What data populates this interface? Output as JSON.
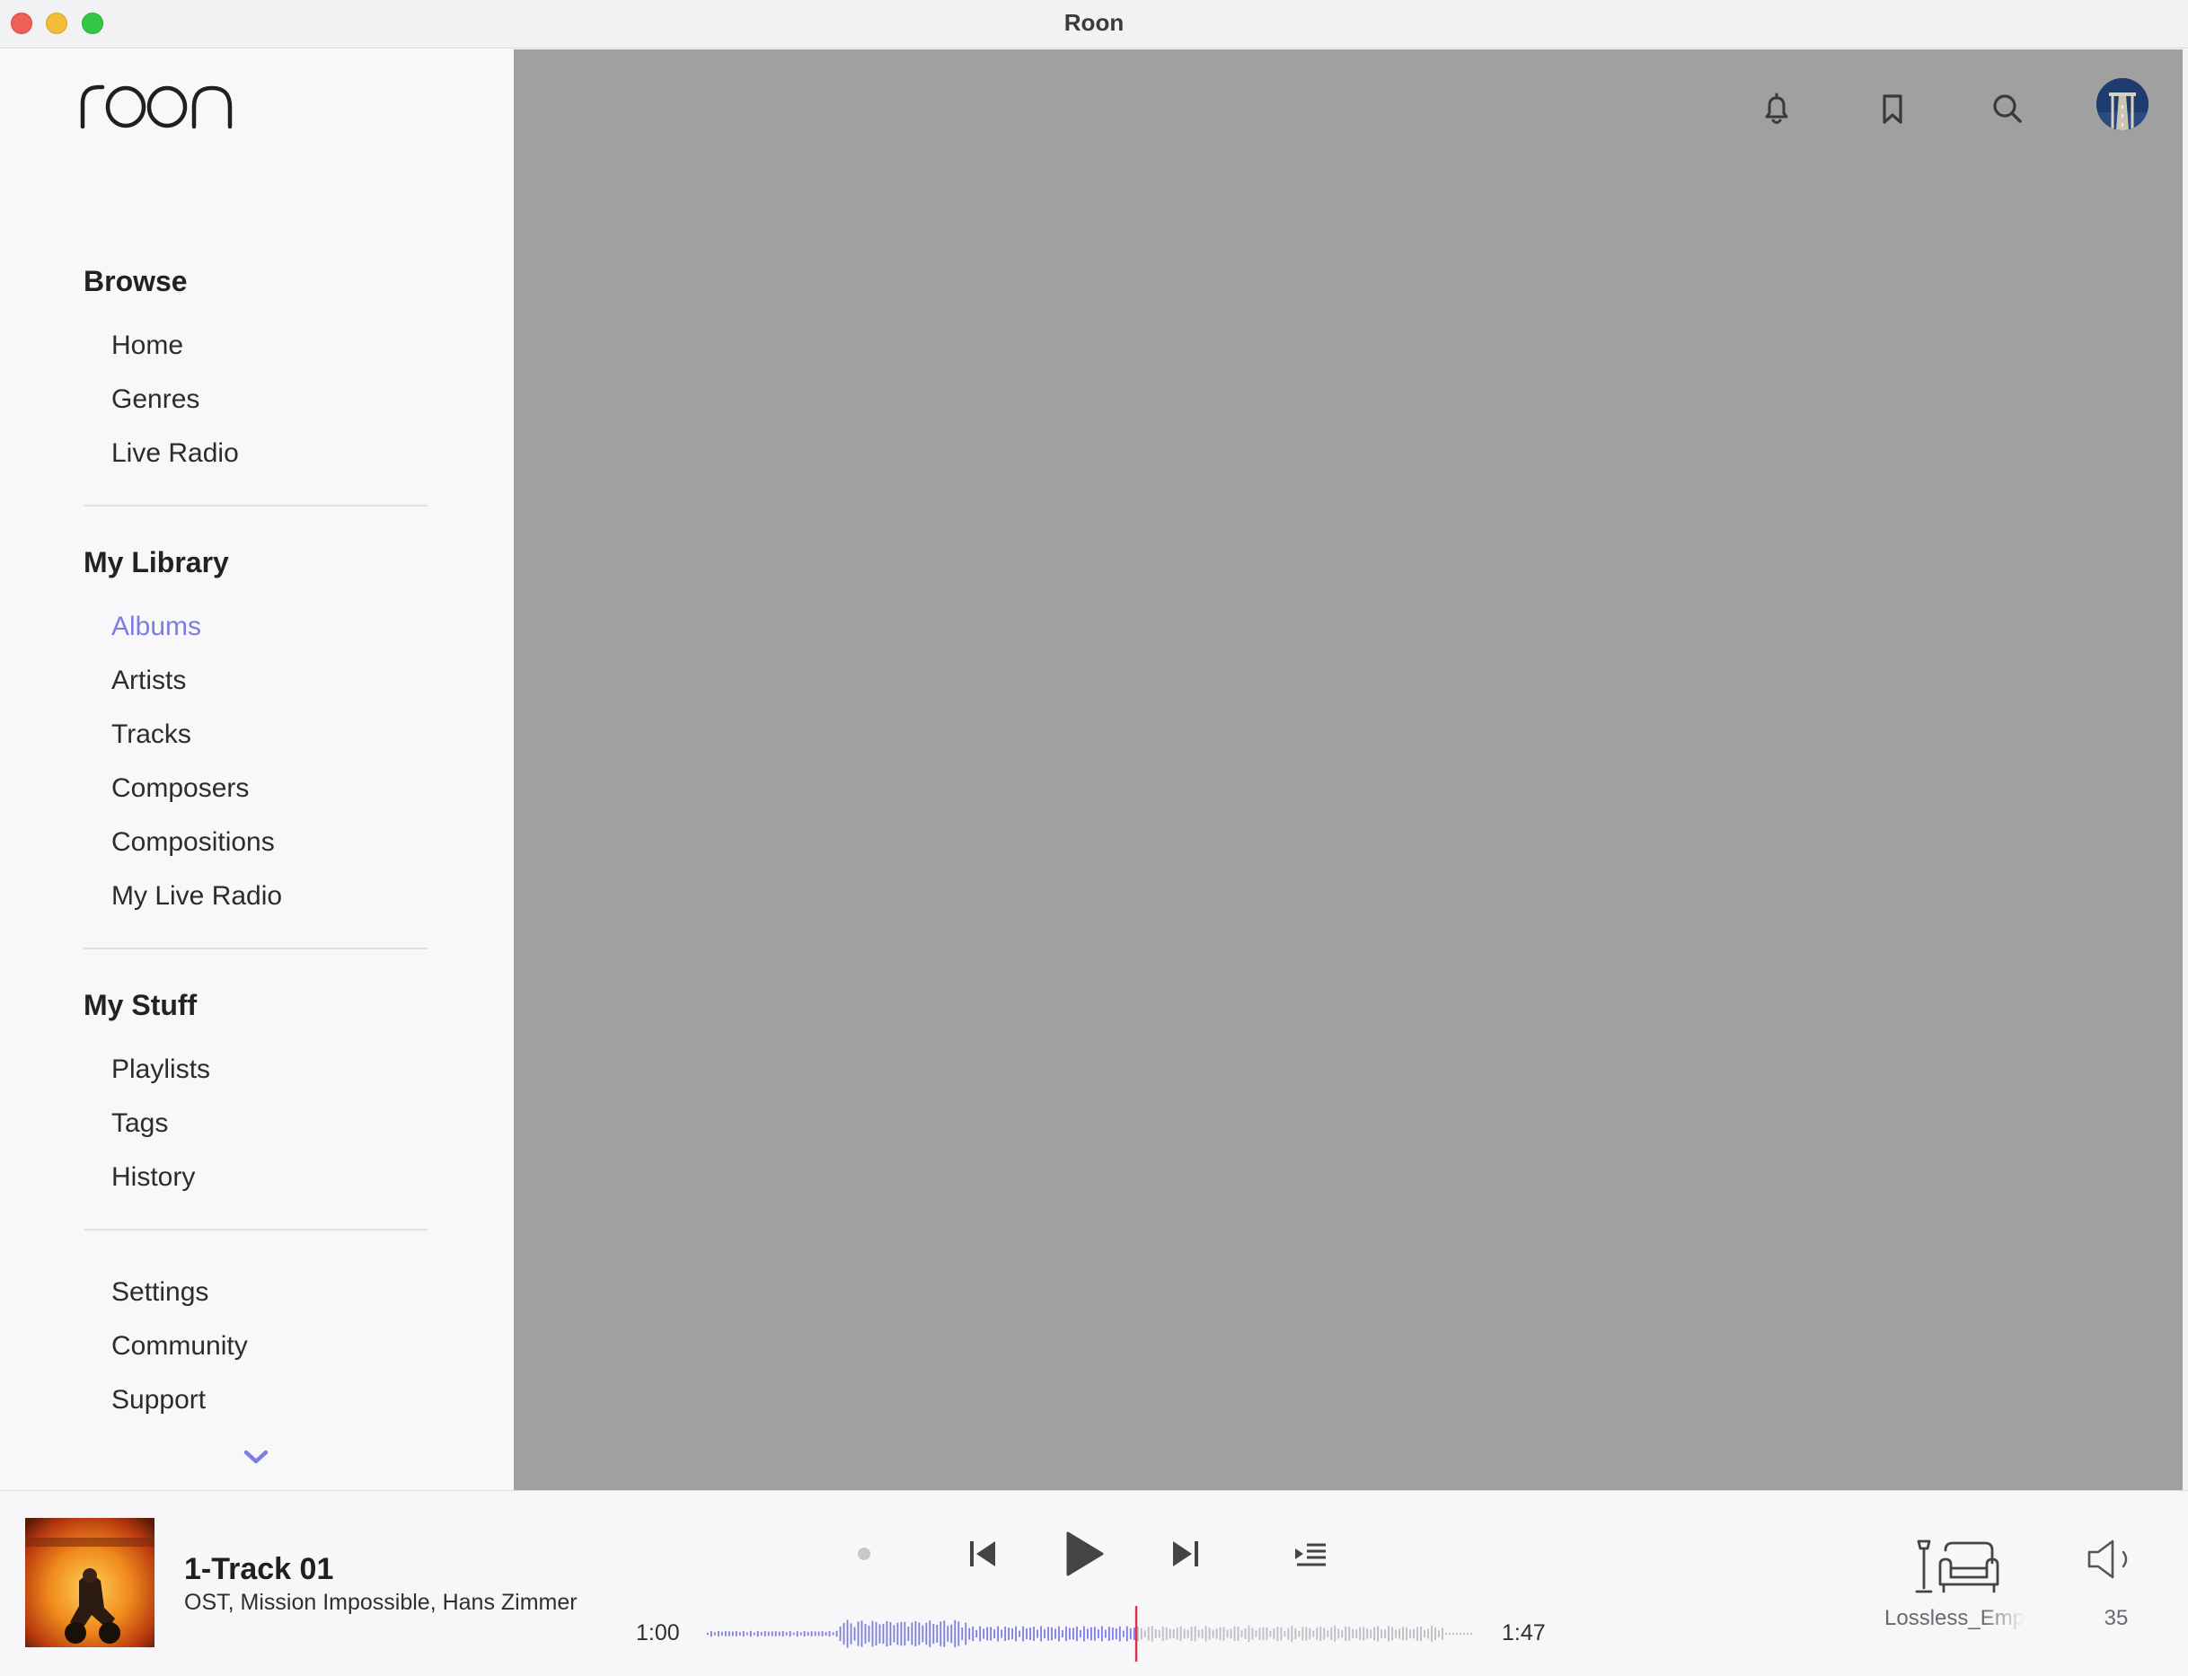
{
  "window": {
    "title": "Roon"
  },
  "sidebar": {
    "sections": [
      {
        "title": "Browse",
        "items": [
          "Home",
          "Genres",
          "Live Radio"
        ]
      },
      {
        "title": "My Library",
        "items": [
          "Albums",
          "Artists",
          "Tracks",
          "Composers",
          "Compositions",
          "My Live Radio"
        ]
      },
      {
        "title": "My Stuff",
        "items": [
          "Playlists",
          "Tags",
          "History"
        ]
      },
      {
        "title": "",
        "items": [
          "Settings",
          "Community",
          "Support"
        ]
      }
    ],
    "active_item": "Albums"
  },
  "header_icons": [
    "bell-icon",
    "bookmark-icon",
    "search-icon",
    "profile-avatar"
  ],
  "player": {
    "track_title": "1-Track 01",
    "track_artist": "OST, Mission Impossible, Hans Zimmer",
    "elapsed": "1:00",
    "duration": "1:47",
    "progress": 0.5607,
    "zone_name": "Lossless_Emporium",
    "volume": "35"
  },
  "colors": {
    "accent": "#7b7ee0",
    "playhead": "#d8314b",
    "main_background": "#a0a0a0"
  }
}
